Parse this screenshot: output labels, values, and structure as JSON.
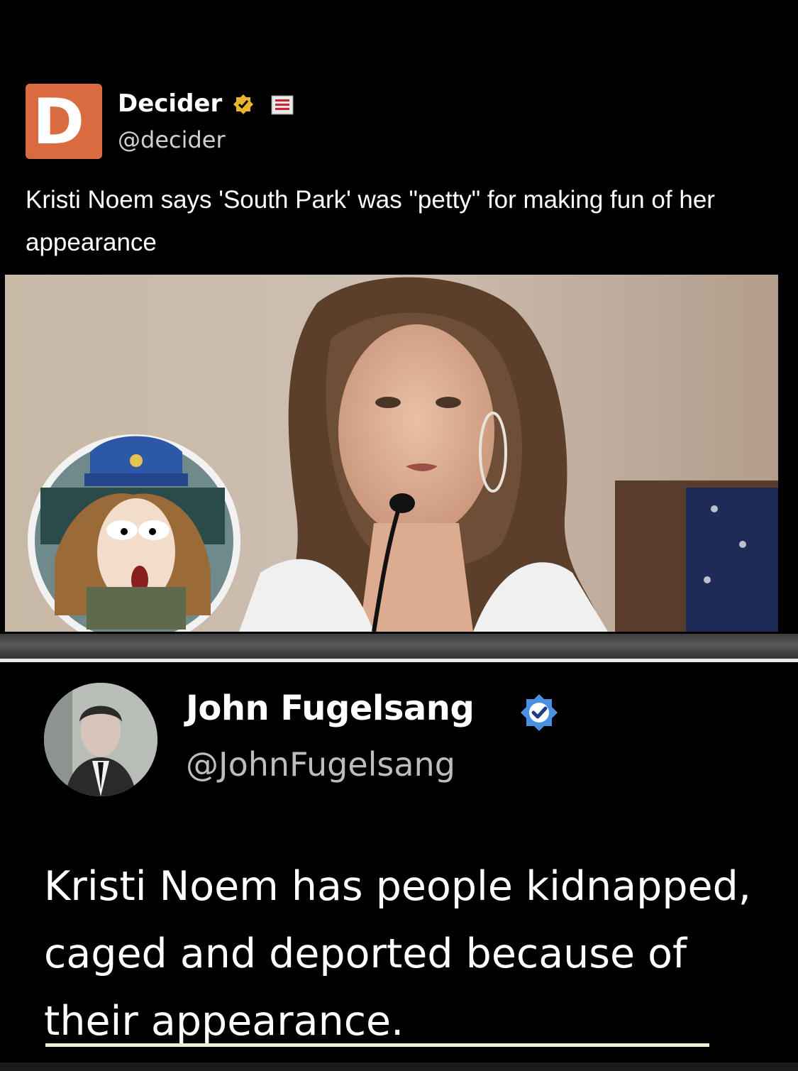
{
  "post1": {
    "author": "Decider",
    "handle": "@decider",
    "avatar_letter": "D",
    "text": "Kristi Noem says 'South Park' was \"petty\" for making fun of her appearance"
  },
  "post2": {
    "author": "John Fugelsang",
    "handle": "@JohnFugelsang",
    "text": "Kristi Noem has people kidnapped, caged and deported because of their appearance."
  },
  "colors": {
    "background": "#000000",
    "decider_brand": "#d86c40",
    "verified_gold": "#e9b530",
    "verified_blue": "#4a90e2",
    "underline": "#f2eecf"
  },
  "icons": {
    "verified_gold": "verified-badge-gold-icon",
    "affiliate": "affiliate-flag-icon",
    "verified_blue": "verified-badge-blue-icon"
  }
}
